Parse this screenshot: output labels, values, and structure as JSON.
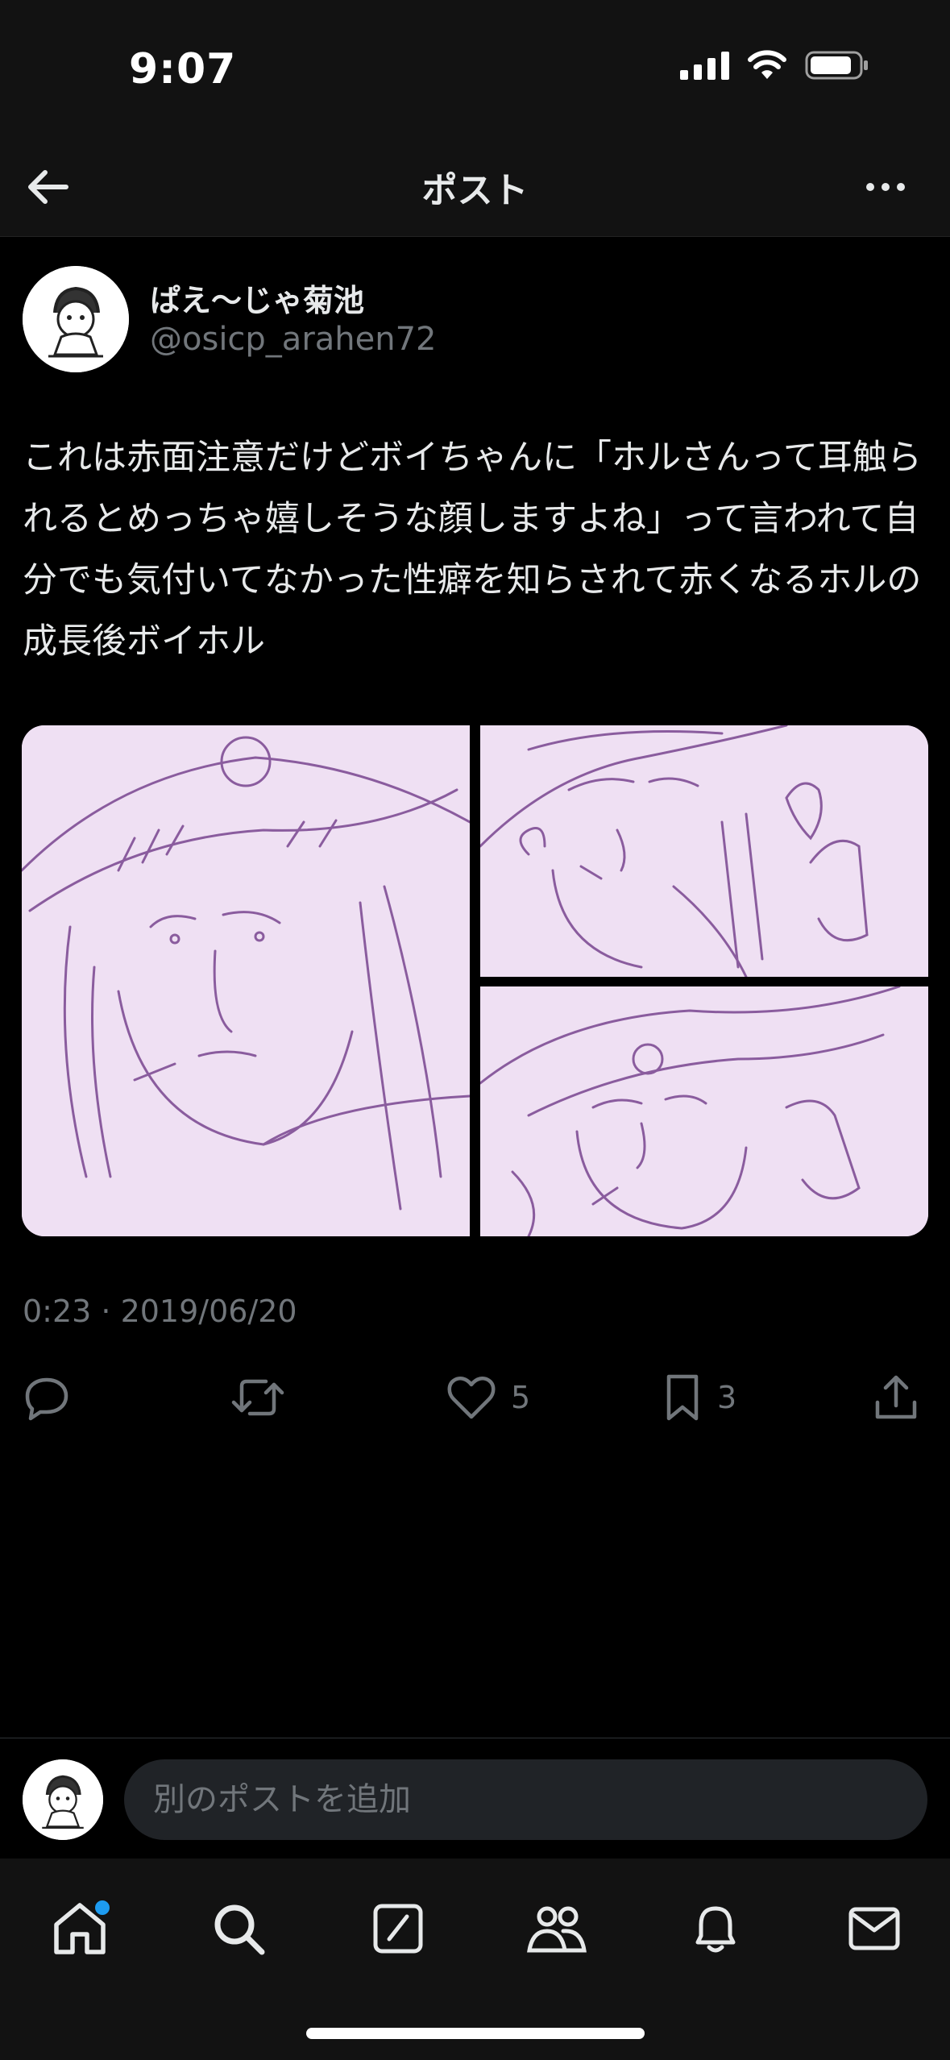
{
  "status_bar": {
    "time": "9:07"
  },
  "header": {
    "title": "ポスト"
  },
  "post": {
    "display_name": "ぱえ〜じゃ菊池",
    "handle": "@osicp_arahen72",
    "text": "これは赤面注意だけどボイちゃんに「ホルさんって耳触られるとめっちゃ嬉しそうな顔しますよね」って言われて自分でも気付いてなかった性癖を知らされて赤くなるホルの成長後ボイホル",
    "timestamp": "0:23 · 2019/06/20",
    "media_count": 3,
    "likes": "5",
    "bookmarks": "3"
  },
  "reply": {
    "placeholder": "別のポストを追加"
  },
  "tabs": [
    {
      "icon": "home-icon",
      "has_notification_dot": true
    },
    {
      "icon": "search-icon"
    },
    {
      "icon": "compose-icon"
    },
    {
      "icon": "communities-icon"
    },
    {
      "icon": "bell-icon"
    },
    {
      "icon": "mail-icon"
    }
  ],
  "colors": {
    "accent": "#1d9bf0",
    "text_primary": "#e7e9ea",
    "text_secondary": "#71767b",
    "sketch_paper": "#efe0f3",
    "sketch_ink": "#8a5c9e"
  }
}
